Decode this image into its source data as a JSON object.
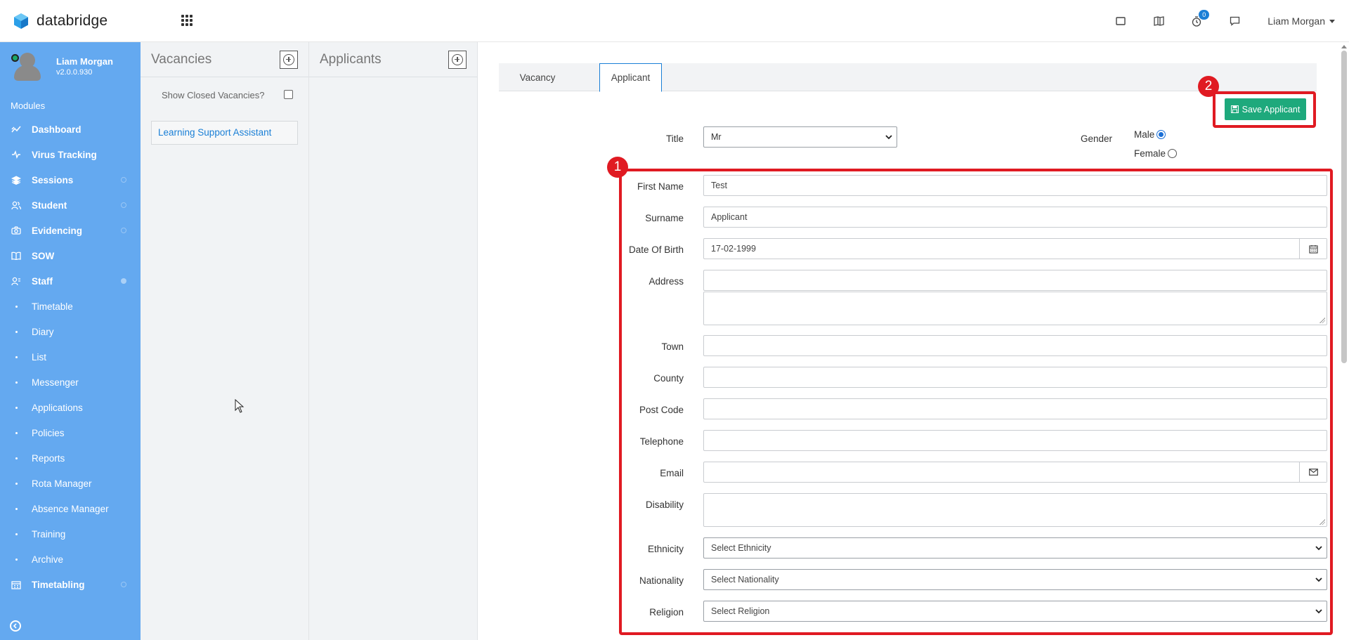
{
  "app": {
    "name": "databridge"
  },
  "header": {
    "badge_count": "0",
    "user_name": "Liam Morgan"
  },
  "sidebar": {
    "profile": {
      "name": "Liam Morgan",
      "version": "v2.0.0.930"
    },
    "modules_label": "Modules",
    "items": [
      {
        "label": "Dashboard",
        "icon": "chart-line-icon"
      },
      {
        "label": "Virus Tracking",
        "icon": "pulse-icon"
      },
      {
        "label": "Sessions",
        "icon": "layers-icon"
      },
      {
        "label": "Student",
        "icon": "users-icon"
      },
      {
        "label": "Evidencing",
        "icon": "camera-icon"
      },
      {
        "label": "SOW",
        "icon": "book-icon"
      },
      {
        "label": "Staff",
        "icon": "staff-icon"
      },
      {
        "label": "Timetable"
      },
      {
        "label": "Diary"
      },
      {
        "label": "List"
      },
      {
        "label": "Messenger"
      },
      {
        "label": "Applications"
      },
      {
        "label": "Policies"
      },
      {
        "label": "Reports"
      },
      {
        "label": "Rota Manager"
      },
      {
        "label": "Absence Manager"
      },
      {
        "label": "Training"
      },
      {
        "label": "Archive"
      },
      {
        "label": "Timetabling",
        "icon": "calendar-icon"
      }
    ]
  },
  "vacancies": {
    "title": "Vacancies",
    "show_closed_label": "Show Closed Vacancies?",
    "items": [
      "Learning Support Assistant"
    ]
  },
  "applicants": {
    "title": "Applicants"
  },
  "main": {
    "tabs": [
      "Vacancy",
      "Applicant"
    ],
    "save_button": "Save Applicant",
    "callout_1": "1",
    "callout_2": "2",
    "form": {
      "title_label": "Title",
      "title_value": "Mr",
      "gender_label": "Gender",
      "gender_male": "Male",
      "gender_female": "Female",
      "gender_selected": "Male",
      "first_name_label": "First Name",
      "first_name_value": "Test",
      "surname_label": "Surname",
      "surname_value": "Applicant",
      "dob_label": "Date Of Birth",
      "dob_value": "17-02-1999",
      "address_label": "Address",
      "town_label": "Town",
      "county_label": "County",
      "postcode_label": "Post Code",
      "telephone_label": "Telephone",
      "email_label": "Email",
      "disability_label": "Disability",
      "ethnicity_label": "Ethnicity",
      "ethnicity_value": "Select Ethnicity",
      "nationality_label": "Nationality",
      "nationality_value": "Select Nationality",
      "religion_label": "Religion",
      "religion_value": "Select Religion"
    }
  },
  "colors": {
    "sidebar": "#64a9f0",
    "accent": "#1a7fd6",
    "save": "#1ea97c",
    "callout": "#e01a22"
  }
}
